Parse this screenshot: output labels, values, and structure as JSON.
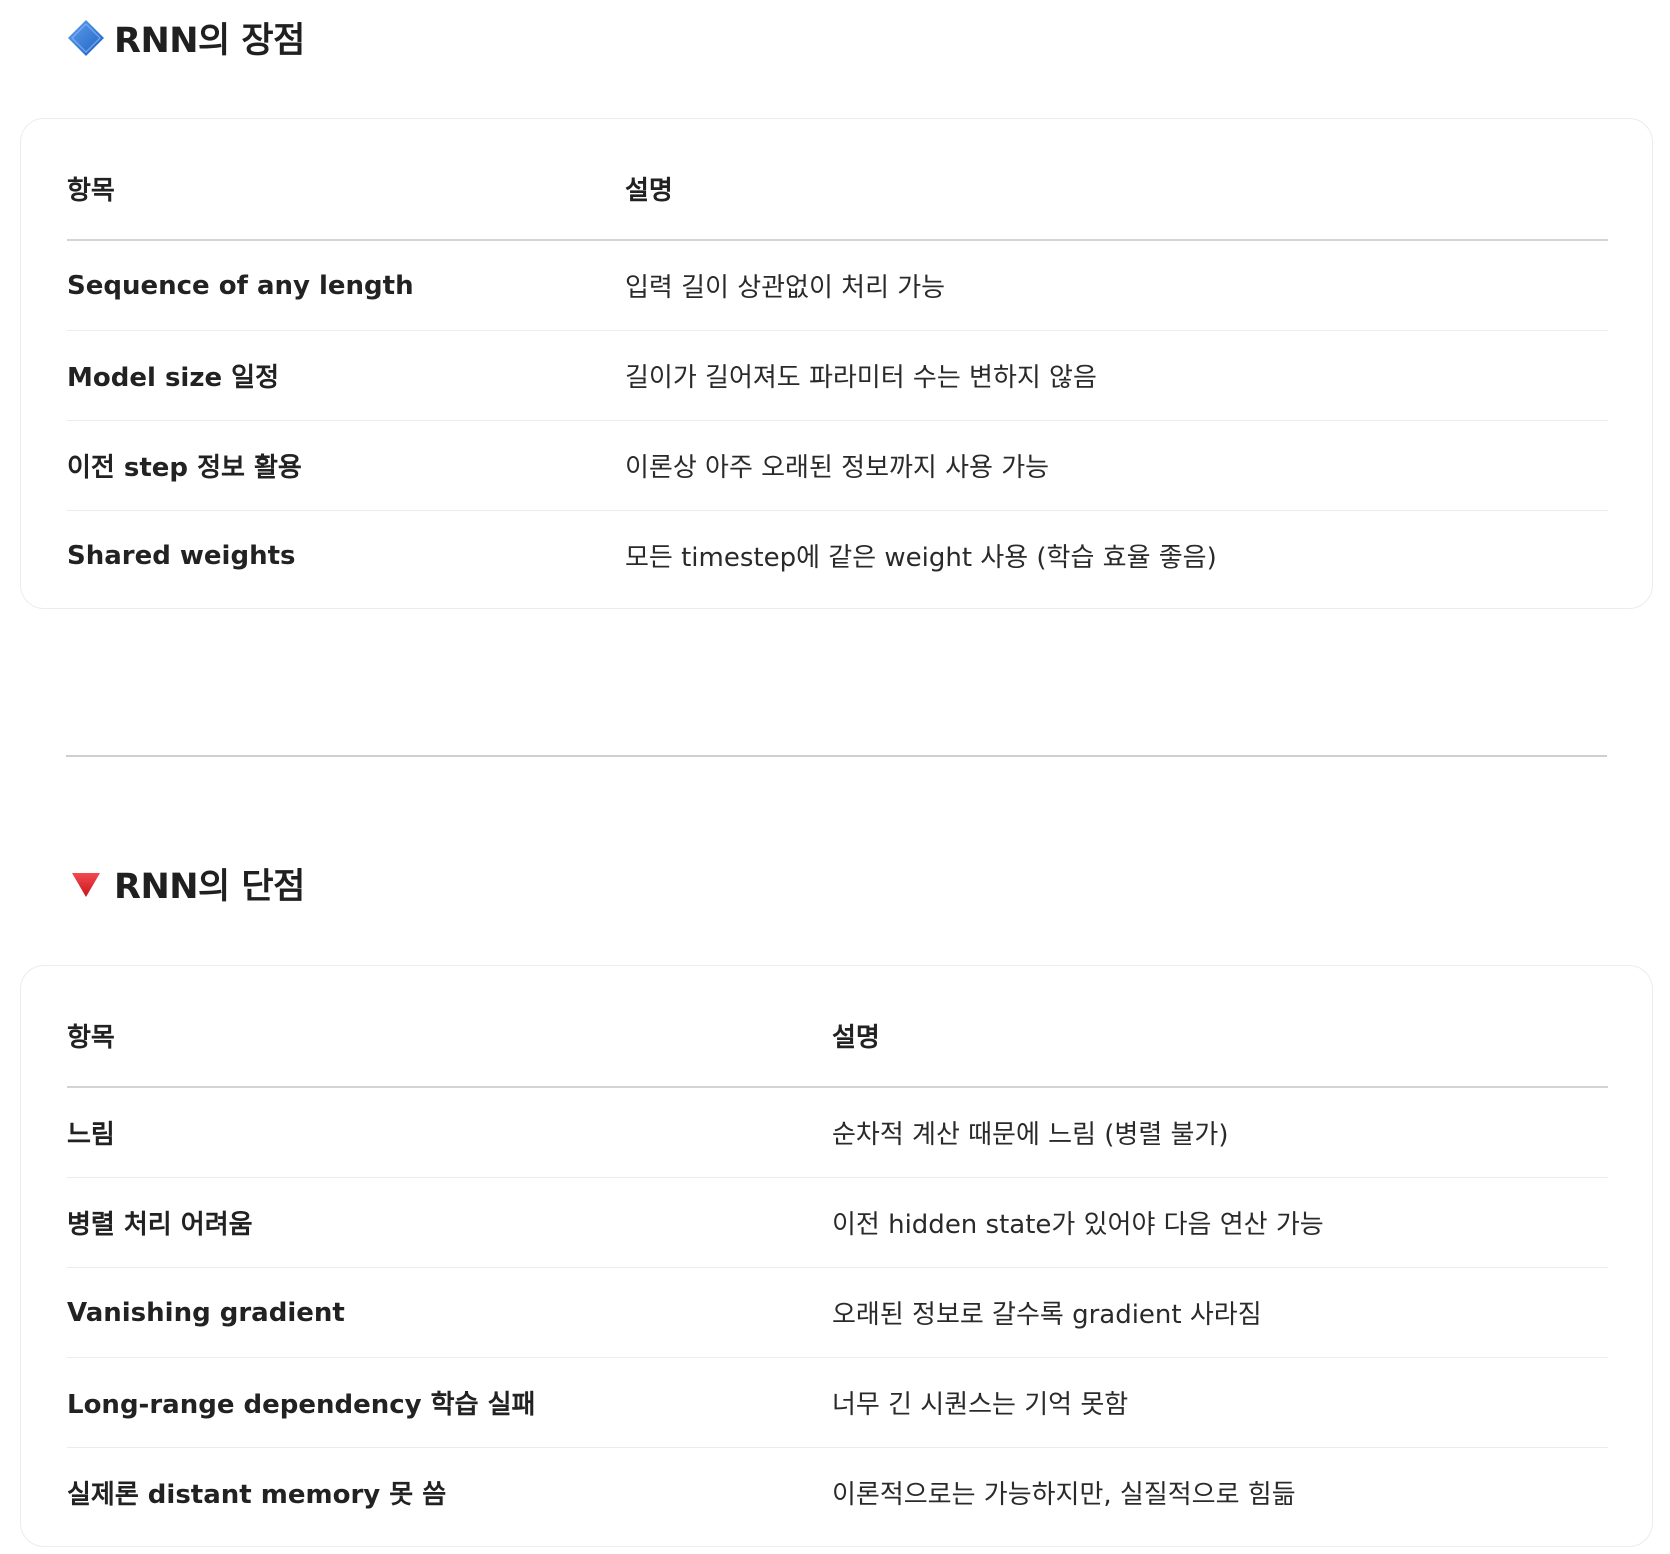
{
  "pros": {
    "icon": "blue-diamond-icon",
    "title": "RNN의 장점",
    "headers": {
      "item": "항목",
      "desc": "설명"
    },
    "rows": [
      {
        "item": "Sequence of any length",
        "desc": "입력 길이 상관없이 처리 가능"
      },
      {
        "item": "Model size 일정",
        "desc": "길이가 길어져도 파라미터 수는 변하지 않음"
      },
      {
        "item": "이전 step 정보 활용",
        "desc": "이론상 아주 오래된 정보까지 사용 가능"
      },
      {
        "item": "Shared weights",
        "desc": "모든 timestep에 같은 weight 사용 (학습 효율 좋음)"
      }
    ]
  },
  "cons": {
    "icon": "red-triangle-down-icon",
    "title": "RNN의 단점",
    "headers": {
      "item": "항목",
      "desc": "설명"
    },
    "rows": [
      {
        "item": "느림",
        "desc": "순차적 계산 때문에 느림 (병렬 불가)"
      },
      {
        "item": "병렬 처리 어려움",
        "desc": "이전 hidden state가 있어야 다음 연산 가능"
      },
      {
        "item": "Vanishing gradient",
        "desc": "오래된 정보로 갈수록 gradient 사라짐"
      },
      {
        "item": "Long-range dependency 학습 실패",
        "desc": "너무 긴 시퀀스는 기억 못함"
      },
      {
        "item": "실제론 distant memory 못 씀",
        "desc": "이론적으로는 가능하지만, 실질적으로 힘듦"
      }
    ]
  },
  "colors": {
    "blue_diamond": "#3a7bd5",
    "red_triangle": "#e0242a"
  }
}
